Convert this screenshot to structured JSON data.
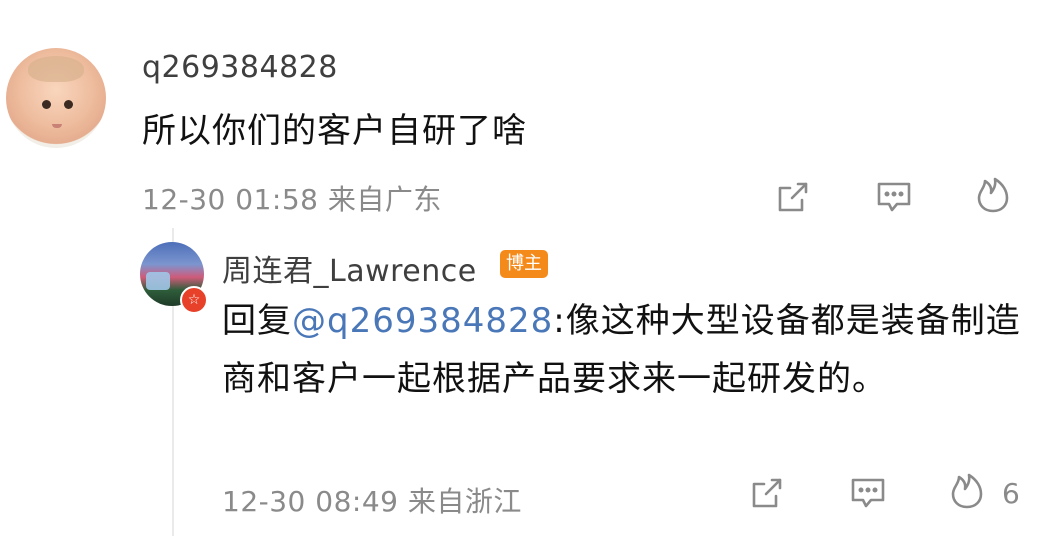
{
  "comment": {
    "username": "q269384828",
    "text": "所以你们的客户自研了啥",
    "time": "12-30 01:58",
    "location": "来自广东",
    "icons": [
      "share-icon",
      "comment-icon",
      "like-icon"
    ]
  },
  "reply": {
    "username": "周连君_Lawrence",
    "badge": "博主",
    "reply_prefix": "回复",
    "mention": "@q269384828",
    "text": ":像这种大型设备都是装备制造商和客户一起根据产品要求来一起研发的。",
    "time": "12-30 08:49",
    "location": "来自浙江",
    "like_count": "6",
    "verified_icon": "weibo-verified-icon"
  },
  "colors": {
    "mention": "#4a77b8",
    "badge_bg": "#f48a1a",
    "verified_badge": "#e8412a",
    "meta_gray": "#8a8a8a"
  }
}
